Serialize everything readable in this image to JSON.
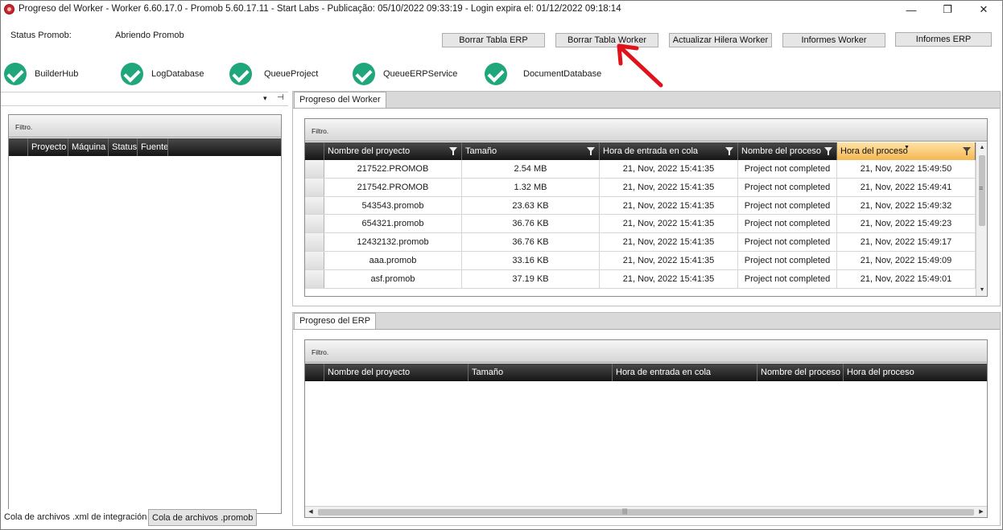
{
  "window": {
    "title": "Progreso del Worker  -  Worker 6.60.17.0  -  Promob 5.60.17.11  -  Start Labs  -  Publicação: 05/10/2022 09:33:19  -  Login expira el: 01/12/2022 09:18:14",
    "minimize_glyph": "—",
    "maximize_glyph": "❐",
    "close_glyph": "✕"
  },
  "status": {
    "label": "Status Promob:",
    "value": "Abriendo Promob"
  },
  "toolbar": {
    "borrar_erp": "Borrar Tabla ERP",
    "borrar_worker": "Borrar Tabla Worker",
    "actualizar_hilera": "Actualizar Hilera Worker",
    "informes_worker": "Informes Worker",
    "informes_erp": "Informes ERP"
  },
  "services": [
    {
      "label": "BuilderHub",
      "icon": "check-circle-icon",
      "color": "#1fa67a"
    },
    {
      "label": "LogDatabase",
      "icon": "check-circle-icon",
      "color": "#1fa67a"
    },
    {
      "label": "QueueProject",
      "icon": "check-circle-icon",
      "color": "#1fa67a"
    },
    {
      "label": "QueueERPService",
      "icon": "check-circle-icon",
      "color": "#1fa67a"
    },
    {
      "label": "DocumentDatabase",
      "icon": "check-circle-icon",
      "color": "#1fa67a"
    }
  ],
  "left_panel": {
    "dropdown_glyph": "▾",
    "pin_glyph": "⊣",
    "filter_label": "Filtro.",
    "columns": [
      "Proyecto",
      "Máquina",
      "Status",
      "Fuente"
    ],
    "tabs": [
      "Cola de archivos .xml de integración",
      "Cola de archivos .promob"
    ]
  },
  "worker_panel": {
    "tab_label": "Progreso del Worker",
    "filter_label": "Filtro.",
    "columns": [
      "Nombre del proyecto",
      "Tamaño",
      "Hora de entrada en cola",
      "Nombre del proceso",
      "Hora del proceso"
    ],
    "rows": [
      [
        "217522.PROMOB",
        "2.54 MB",
        "21, Nov, 2022 15:41:35",
        "Project not completed",
        "21, Nov, 2022 15:49:50"
      ],
      [
        "217542.PROMOB",
        "1.32 MB",
        "21, Nov, 2022 15:41:35",
        "Project not completed",
        "21, Nov, 2022 15:49:41"
      ],
      [
        "543543.promob",
        "23.63 KB",
        "21, Nov, 2022 15:41:35",
        "Project not completed",
        "21, Nov, 2022 15:49:32"
      ],
      [
        "654321.promob",
        "36.76 KB",
        "21, Nov, 2022 15:41:35",
        "Project not completed",
        "21, Nov, 2022 15:49:23"
      ],
      [
        "12432132.promob",
        "36.76 KB",
        "21, Nov, 2022 15:41:35",
        "Project not completed",
        "21, Nov, 2022 15:49:17"
      ],
      [
        "aaa.promob",
        "33.16 KB",
        "21, Nov, 2022 15:41:35",
        "Project not completed",
        "21, Nov, 2022 15:49:09"
      ],
      [
        "asf.promob",
        "37.19 KB",
        "21, Nov, 2022 15:41:35",
        "Project not completed",
        "21, Nov, 2022 15:49:01"
      ]
    ],
    "selected_column_color": "#f5b653"
  },
  "erp_panel": {
    "tab_label": "Progreso del ERP",
    "filter_label": "Filtro.",
    "columns": [
      "Nombre del proyecto",
      "Tamaño",
      "Hora de entrada en cola",
      "Nombre del proceso",
      "Hora del proceso"
    ]
  },
  "scroll": {
    "up": "▲",
    "down": "▼",
    "left": "◀",
    "right": "▶",
    "grip_v": "≡",
    "grip_h": "|||"
  },
  "annotation_color": "#e0121b"
}
